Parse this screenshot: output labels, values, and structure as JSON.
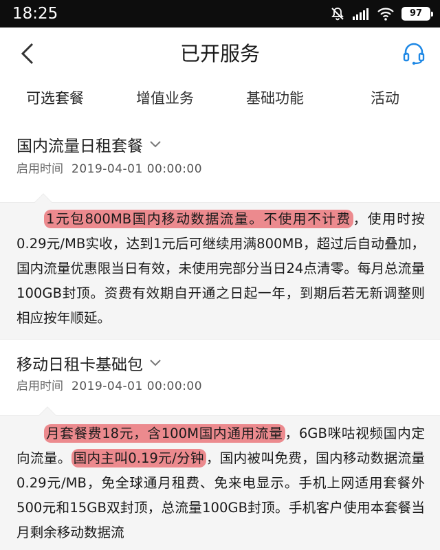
{
  "status_bar": {
    "time": "18:25",
    "battery": "97",
    "icons": [
      "mute-bell-icon",
      "signal-icon",
      "wifi-icon",
      "battery-icon"
    ]
  },
  "header": {
    "title": "已开服务",
    "icons": [
      "back-arrow-icon",
      "headset-icon"
    ],
    "accent_color": "#1e88e5"
  },
  "tabs": [
    {
      "label": "可选套餐",
      "active": true
    },
    {
      "label": "增值业务",
      "active": false
    },
    {
      "label": "基础功能",
      "active": false
    },
    {
      "label": "活动",
      "active": false
    }
  ],
  "sections": [
    {
      "title": "国内流量日租套餐",
      "start_label": "启用时间",
      "start_value": "2019-04-01   00:00:00",
      "desc": [
        {
          "text": "1元包800MB国内移动数据流量。不使用不计费",
          "highlight": true
        },
        {
          "text": "，使用时按0.29元/MB实收，达到1元后可继续用满800MB，超过后自动叠加，国内流量优惠限当日有效，未使用完部分当日24点清零。每月总流量100GB封顶。资费有效期自开通之日起一年，到期后若无新调整则相应按年顺延。",
          "highlight": false
        }
      ]
    },
    {
      "title": "移动日租卡基础包",
      "start_label": "启用时间",
      "start_value": "2019-04-01   00:00:00",
      "desc": [
        {
          "text": "月套餐费18元，含100M国内通用流量",
          "highlight": true
        },
        {
          "text": "，6GB咪咕视频国内定向流量。",
          "highlight": false
        },
        {
          "text": "国内主叫0.19元/分钟",
          "highlight": true
        },
        {
          "text": "，国内被叫免费，国内移动数据流量0.29元/MB，免全球通月租费、免来电显示。手机上网适用套餐外500元和15GB双封顶，总流量100GB封顶。手机客户使用本套餐当月剩余移动数据流",
          "highlight": false
        }
      ]
    }
  ],
  "colors": {
    "highlight": "#ec8a8e",
    "desc_bg": "#f5f5f5",
    "status_bar": "#0d0d0d"
  }
}
